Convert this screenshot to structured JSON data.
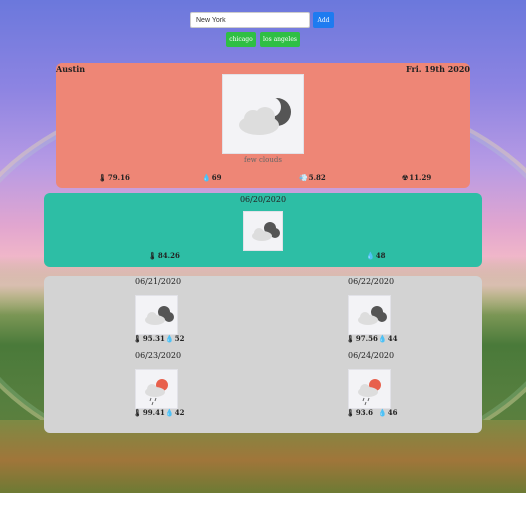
{
  "search": {
    "value": "New York",
    "add_label": "Add"
  },
  "saved_cities": [
    "chicago",
    "los angeles"
  ],
  "current": {
    "city": "Austin",
    "date": "Fri. 19th 2020",
    "icon": "few-clouds-night-icon",
    "description": "few clouds",
    "temperature": "79.16",
    "humidity": "69",
    "wind": "5.82",
    "clouds": "11.29"
  },
  "tomorrow": {
    "date": "06/20/2020",
    "icon": "clouds-night-icon",
    "temperature": "84.26",
    "humidity": "48"
  },
  "forecast": [
    {
      "date": "06/21/2020",
      "icon": "clouds-night-icon",
      "temperature": "95.31",
      "humidity": "52"
    },
    {
      "date": "06/22/2020",
      "icon": "clouds-night-icon",
      "temperature": "97.56",
      "humidity": "44"
    },
    {
      "date": "06/23/2020",
      "icon": "rain-day-icon",
      "temperature": "99.41",
      "humidity": "42"
    },
    {
      "date": "06/24/2020",
      "icon": "rain-day-icon",
      "temperature": "93.6",
      "humidity": "46"
    }
  ],
  "colors": {
    "today": "#ee8676",
    "tomorrow": "#2dbea5",
    "forecast": "#d3d3d3",
    "add": "#1e7bf0",
    "city": "#2fbf44"
  }
}
